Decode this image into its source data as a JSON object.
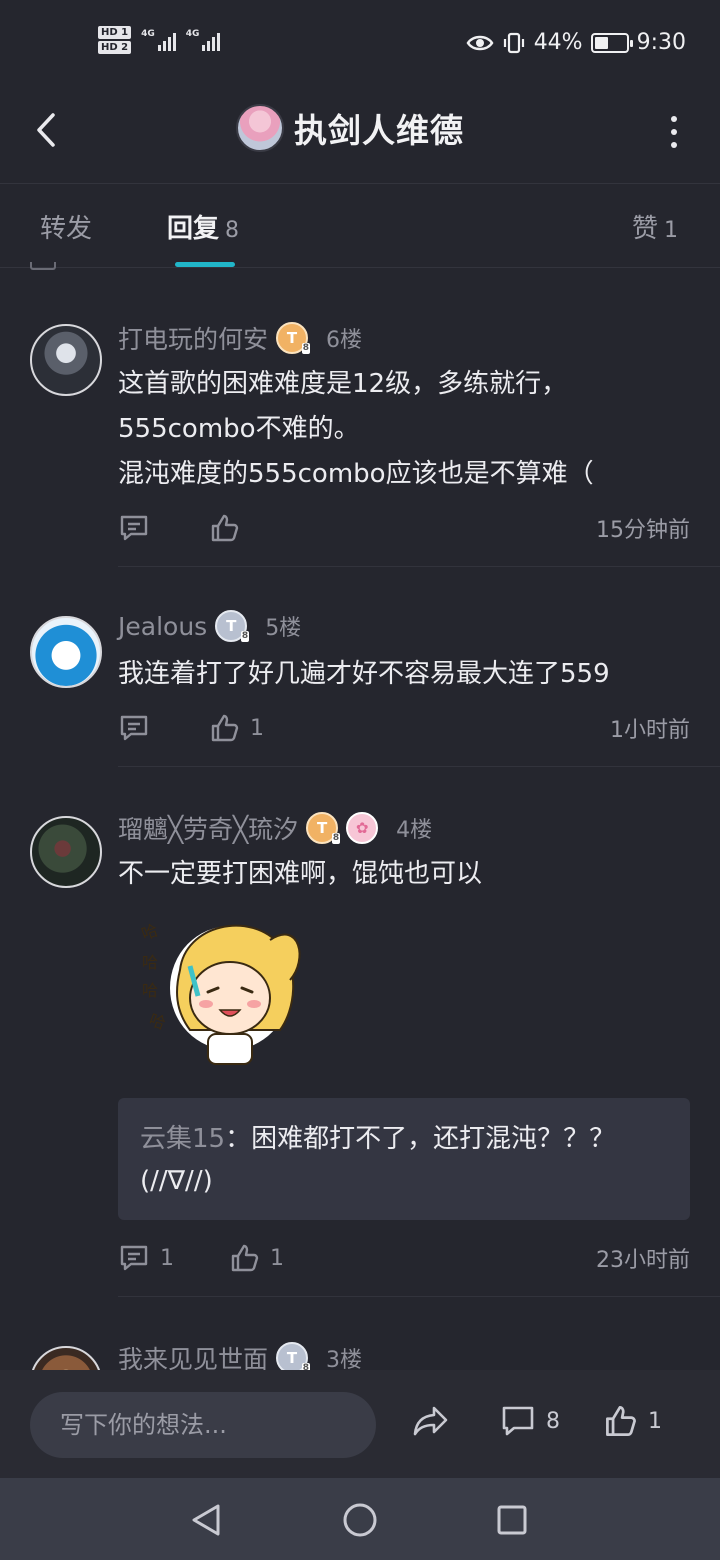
{
  "status": {
    "hd1": "HD 1",
    "hd2": "HD 2",
    "net1": "4G",
    "net2": "4G",
    "battery_pct": "44%",
    "battery_level": 0.44,
    "time": "9:30"
  },
  "header": {
    "title": "执剑人维德"
  },
  "tabs": {
    "repost": "转发",
    "reply": "回复",
    "reply_count": "8",
    "like": "赞",
    "like_count": "1"
  },
  "comments": [
    {
      "name": "打电玩的何安",
      "floor": "6楼",
      "lines": [
        "这首歌的困难难度是12级，多练就行，",
        "555combo不难的。",
        "混沌难度的555combo应该也是不算难（"
      ],
      "reply_count": "",
      "like_count": "",
      "time": "15分钟前"
    },
    {
      "name": "Jealous",
      "floor": "5楼",
      "lines": [
        "我连着打了好几遍才好不容易最大连了559"
      ],
      "reply_count": "",
      "like_count": "1",
      "time": "1小时前"
    },
    {
      "name": "瑠魑╳劳奇╳琉汐",
      "floor": "4楼",
      "lines": [
        "不一定要打困难啊，馄饨也可以"
      ],
      "quote_name": "云集15",
      "quote_text": "：困难都打不了，还打混沌？？？",
      "quote_text2": "(//∇//)",
      "reply_count": "1",
      "like_count": "1",
      "time": "23小时前"
    },
    {
      "name": "我来见见世面",
      "floor": "3楼"
    }
  ],
  "bottom": {
    "input_placeholder": "写下你的想法...",
    "comment_count": "8",
    "like_count": "1"
  },
  "badge_letters": {
    "tier": "T",
    "level": "8"
  }
}
